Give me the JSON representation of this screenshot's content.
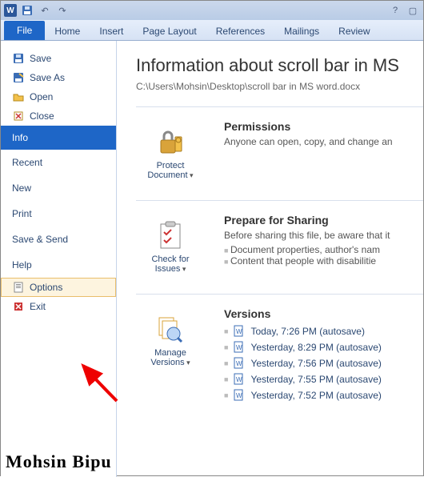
{
  "qat": {
    "app": "W"
  },
  "tabs": {
    "file": "File",
    "home": "Home",
    "insert": "Insert",
    "layout": "Page Layout",
    "refs": "References",
    "mail": "Mailings",
    "review": "Review"
  },
  "side": {
    "save": "Save",
    "saveas": "Save As",
    "open": "Open",
    "close": "Close",
    "info": "Info",
    "recent": "Recent",
    "new": "New",
    "print": "Print",
    "sendsave": "Save & Send",
    "help": "Help",
    "options": "Options",
    "exit": "Exit"
  },
  "main": {
    "title": "Information about scroll bar in MS",
    "path": "C:\\Users\\Mohsin\\Desktop\\scroll bar in MS word.docx",
    "perm": {
      "btn": "Protect Document",
      "h": "Permissions",
      "p": "Anyone can open, copy, and change an"
    },
    "share": {
      "btn": "Check for Issues",
      "h": "Prepare for Sharing",
      "p": "Before sharing this file, be aware that it",
      "b1": "Document properties, author's nam",
      "b2": "Content that people with disabilitie"
    },
    "ver": {
      "btn": "Manage Versions",
      "h": "Versions",
      "items": [
        "Today, 7:26 PM (autosave)",
        "Yesterday, 8:29 PM (autosave)",
        "Yesterday, 7:56 PM (autosave)",
        "Yesterday, 7:55 PM (autosave)",
        "Yesterday, 7:52 PM (autosave)"
      ]
    }
  },
  "watermark": "Mohsin Bipu"
}
